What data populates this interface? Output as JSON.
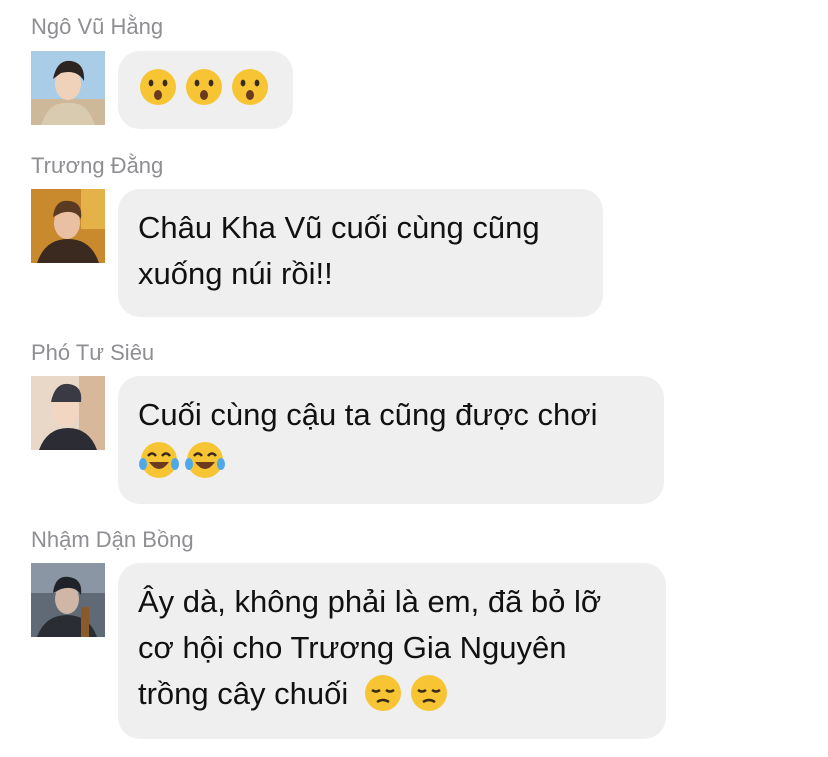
{
  "messages": [
    {
      "sender": "Ngô Vũ Hằng",
      "lines": [],
      "emoji": [
        "hushed-face-emoji",
        "hushed-face-emoji",
        "hushed-face-emoji"
      ]
    },
    {
      "sender": "Trương Đằng",
      "lines": [
        "Châu Kha Vũ cuối cùng cũng",
        "xuống núi rồi!!"
      ]
    },
    {
      "sender": "Phó Tư Siêu",
      "lines": [
        "Cuối cùng cậu ta cũng được chơi"
      ],
      "emoji": [
        "tears-of-joy-emoji",
        "tears-of-joy-emoji"
      ]
    },
    {
      "sender": "Nhậm Dận Bồng",
      "lines": [
        "Ây dà, không phải là em, đã bỏ lỡ",
        "cơ hội cho Trương Gia Nguyên",
        "trồng cây chuối"
      ],
      "emoji": [
        "pensive-face-emoji",
        "pensive-face-emoji"
      ]
    }
  ],
  "colors": {
    "bubble": "#efefef",
    "sender_name": "#8e8e93",
    "text": "#111111",
    "emoji_yellow": "#f7c534"
  }
}
